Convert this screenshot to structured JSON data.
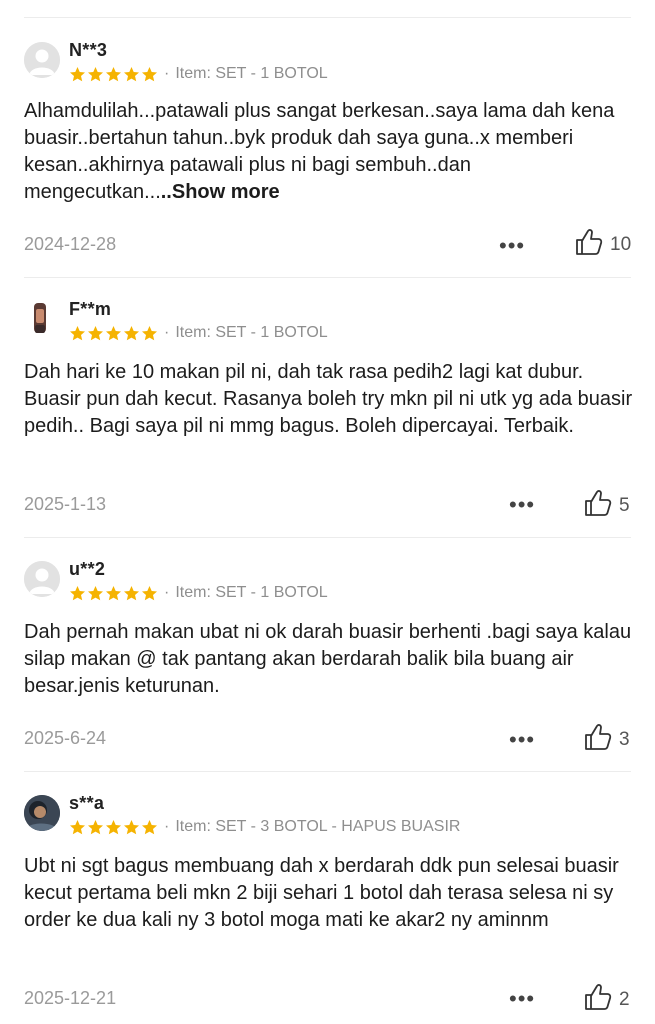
{
  "reviews": [
    {
      "username": "N**3",
      "rating": 5,
      "item": "Item: SET - 1 BOTOL",
      "text": "Alhamdulilah...patawali plus sangat berkesan..saya lama dah kena buasir..bertahun tahun..byk produk dah saya guna..x memberi kesan..akhirnya patawali plus ni bagi sembuh..dan mengecutkan...",
      "show_more": "..Show more",
      "date": "2024-12-28",
      "likes": "10"
    },
    {
      "username": "F**m",
      "rating": 5,
      "item": "Item: SET - 1 BOTOL",
      "text": "Dah hari ke 10 makan pil ni, dah tak rasa pedih2 lagi kat dubur. Buasir pun dah kecut. Rasanya boleh try mkn pil ni utk yg ada buasir pedih.. Bagi saya pil ni mmg bagus. Boleh dipercayai. Terbaik.",
      "date": "2025-1-13",
      "likes": "5"
    },
    {
      "username": "u**2",
      "rating": 5,
      "item": "Item: SET - 1 BOTOL",
      "text": "Dah pernah makan ubat ni ok darah buasir berhenti .bagi saya kalau silap makan @ tak pantang akan berdarah balik bila buang air besar.jenis keturunan.",
      "date": "2025-6-24",
      "likes": "3"
    },
    {
      "username": "s**a",
      "rating": 5,
      "item": "Item: SET - 3 BOTOL - HAPUS BUASIR",
      "text": "Ubt ni sgt bagus membuang dah x berdarah ddk pun selesai buasir kecut pertama beli mkn 2 biji sehari 1 botol dah terasa selesa ni sy order ke dua kali ny 3 botol moga mati ke akar2 ny aminnm",
      "date": "2025-12-21",
      "likes": "2"
    }
  ],
  "ui": {
    "item_separator": "·",
    "more_glyph": "•••",
    "star_color": "#f5b301",
    "icons": [
      "default-avatar-icon",
      "user-photo-avatar",
      "star-icon",
      "more-options-icon",
      "thumbs-up-icon"
    ]
  }
}
